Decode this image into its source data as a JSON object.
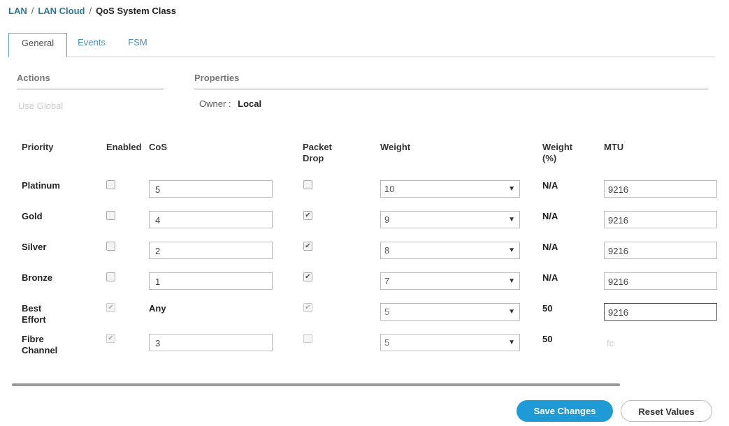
{
  "breadcrumb": [
    "LAN",
    "LAN Cloud",
    "QoS System Class"
  ],
  "tabs": [
    "General",
    "Events",
    "FSM"
  ],
  "actions": {
    "title": "Actions",
    "use_global": "Use Global"
  },
  "properties": {
    "title": "Properties",
    "owner_label": "Owner :",
    "owner_value": "Local"
  },
  "table": {
    "headers": {
      "priority": "Priority",
      "enabled": "Enabled",
      "cos": "CoS",
      "packet_drop_1": "Packet",
      "packet_drop_2": "Drop",
      "weight": "Weight",
      "weight_pct_1": "Weight",
      "weight_pct_2": "(%)",
      "mtu": "MTU"
    },
    "rows": [
      {
        "p1": "Platinum",
        "p2": "",
        "enabled": false,
        "enabled_disabled": false,
        "cos": "5",
        "cos_input": true,
        "drop": false,
        "drop_disabled": false,
        "weight": "10",
        "pct": "N/A",
        "mtu": "9216",
        "mtu_input": true
      },
      {
        "p1": "Gold",
        "p2": "",
        "enabled": false,
        "enabled_disabled": false,
        "cos": "4",
        "cos_input": true,
        "drop": true,
        "drop_disabled": false,
        "weight": "9",
        "pct": "N/A",
        "mtu": "9216",
        "mtu_input": true
      },
      {
        "p1": "Silver",
        "p2": "",
        "enabled": false,
        "enabled_disabled": false,
        "cos": "2",
        "cos_input": true,
        "drop": true,
        "drop_disabled": false,
        "weight": "8",
        "pct": "N/A",
        "mtu": "9216",
        "mtu_input": true
      },
      {
        "p1": "Bronze",
        "p2": "",
        "enabled": false,
        "enabled_disabled": false,
        "cos": "1",
        "cos_input": true,
        "drop": true,
        "drop_disabled": false,
        "weight": "7",
        "pct": "N/A",
        "mtu": "9216",
        "mtu_input": true
      },
      {
        "p1": "Best",
        "p2": "Effort",
        "enabled": true,
        "enabled_disabled": true,
        "cos": "Any",
        "cos_input": false,
        "drop": true,
        "drop_disabled": true,
        "weight": "5",
        "pct": "50",
        "mtu": "9216",
        "mtu_input": true
      },
      {
        "p1": "Fibre",
        "p2": "Channel",
        "enabled": true,
        "enabled_disabled": true,
        "cos": "3",
        "cos_input": true,
        "drop": false,
        "drop_disabled": true,
        "weight": "5",
        "pct": "50",
        "mtu": "fc",
        "mtu_input": false
      }
    ]
  },
  "buttons": {
    "save": "Save Changes",
    "reset": "Reset Values"
  },
  "colors": {
    "accent": "#1e9ad6",
    "link": "#2a7a9b"
  }
}
